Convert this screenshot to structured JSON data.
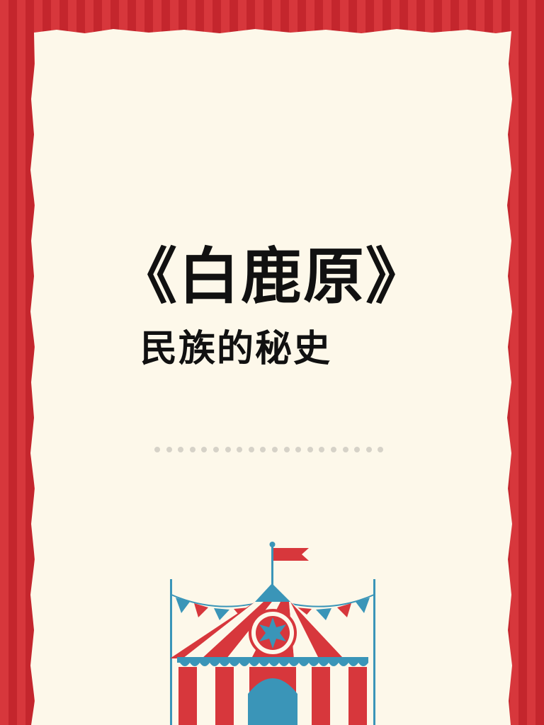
{
  "title": "《白鹿原》",
  "subtitle": "民族的秘史",
  "colors": {
    "frame_red": "#d7373c",
    "frame_red_dark": "#c4262d",
    "paper": "#fdf8ea",
    "tent_blue": "#3a95b8",
    "text": "#111111"
  },
  "decorations": {
    "divider": "dotted-divider",
    "illustration": "circus-tent-icon",
    "flag": "flag-icon"
  }
}
